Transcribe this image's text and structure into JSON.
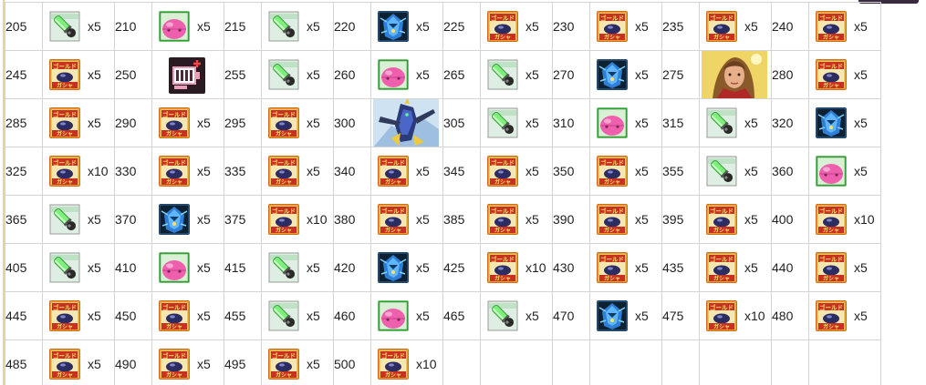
{
  "rows": [
    [
      {
        "n": "205",
        "icon": "tube-item-icon",
        "qty": "x5"
      },
      {
        "n": "210",
        "icon": "pink-haro-icon",
        "qty": "x5"
      },
      {
        "n": "215",
        "icon": "tube-item-icon",
        "qty": "x5"
      },
      {
        "n": "220",
        "icon": "blue-mech-icon",
        "qty": "x5"
      },
      {
        "n": "225",
        "icon": "gold-gacha-ticket-icon",
        "qty": "x5"
      },
      {
        "n": "230",
        "icon": "gold-gacha-ticket-icon",
        "qty": "x5"
      },
      {
        "n": "235",
        "icon": "gold-gacha-ticket-icon",
        "qty": "x5"
      },
      {
        "n": "240",
        "icon": "gold-gacha-ticket-icon",
        "qty": "x5"
      }
    ],
    [
      {
        "n": "245",
        "icon": "gold-gacha-ticket-icon",
        "qty": "x5"
      },
      {
        "n": "250",
        "icon": "slot-expansion-icon",
        "qty": ""
      },
      {
        "n": "255",
        "icon": "tube-item-icon",
        "qty": "x5"
      },
      {
        "n": "260",
        "icon": "pink-haro-icon",
        "qty": "x5"
      },
      {
        "n": "265",
        "icon": "tube-item-icon",
        "qty": "x5"
      },
      {
        "n": "270",
        "icon": "blue-mech-icon",
        "qty": "x5"
      },
      {
        "n": "275",
        "icon": "pilot-portrait-icon",
        "qty": ""
      },
      {
        "n": "280",
        "icon": "gold-gacha-ticket-icon",
        "qty": "x5"
      }
    ],
    [
      {
        "n": "285",
        "icon": "gold-gacha-ticket-icon",
        "qty": "x5"
      },
      {
        "n": "290",
        "icon": "gold-gacha-ticket-icon",
        "qty": "x5"
      },
      {
        "n": "295",
        "icon": "gold-gacha-ticket-icon",
        "qty": "x5"
      },
      {
        "n": "300",
        "icon": "mobile-suit-art-icon",
        "qty": ""
      },
      {
        "n": "305",
        "icon": "tube-item-icon",
        "qty": "x5"
      },
      {
        "n": "310",
        "icon": "pink-haro-icon",
        "qty": "x5"
      },
      {
        "n": "315",
        "icon": "tube-item-icon",
        "qty": "x5"
      },
      {
        "n": "320",
        "icon": "blue-mech-icon",
        "qty": "x5"
      }
    ],
    [
      {
        "n": "325",
        "icon": "gold-gacha-ticket-icon",
        "qty": "x10"
      },
      {
        "n": "330",
        "icon": "gold-gacha-ticket-icon",
        "qty": "x5"
      },
      {
        "n": "335",
        "icon": "gold-gacha-ticket-icon",
        "qty": "x5"
      },
      {
        "n": "340",
        "icon": "gold-gacha-ticket-icon",
        "qty": "x5"
      },
      {
        "n": "345",
        "icon": "gold-gacha-ticket-icon",
        "qty": "x5"
      },
      {
        "n": "350",
        "icon": "gold-gacha-ticket-icon",
        "qty": "x5"
      },
      {
        "n": "355",
        "icon": "tube-item-icon",
        "qty": "x5"
      },
      {
        "n": "360",
        "icon": "pink-haro-icon",
        "qty": "x5"
      }
    ],
    [
      {
        "n": "365",
        "icon": "tube-item-icon",
        "qty": "x5"
      },
      {
        "n": "370",
        "icon": "blue-mech-icon",
        "qty": "x5"
      },
      {
        "n": "375",
        "icon": "gold-gacha-ticket-icon",
        "qty": "x10"
      },
      {
        "n": "380",
        "icon": "gold-gacha-ticket-icon",
        "qty": "x5"
      },
      {
        "n": "385",
        "icon": "gold-gacha-ticket-icon",
        "qty": "x5"
      },
      {
        "n": "390",
        "icon": "gold-gacha-ticket-icon",
        "qty": "x5"
      },
      {
        "n": "395",
        "icon": "gold-gacha-ticket-icon",
        "qty": "x5"
      },
      {
        "n": "400",
        "icon": "gold-gacha-ticket-icon",
        "qty": "x10"
      }
    ],
    [
      {
        "n": "405",
        "icon": "tube-item-icon",
        "qty": "x5"
      },
      {
        "n": "410",
        "icon": "pink-haro-icon",
        "qty": "x5"
      },
      {
        "n": "415",
        "icon": "tube-item-icon",
        "qty": "x5"
      },
      {
        "n": "420",
        "icon": "blue-mech-icon",
        "qty": "x5"
      },
      {
        "n": "425",
        "icon": "gold-gacha-ticket-icon",
        "qty": "x10"
      },
      {
        "n": "430",
        "icon": "gold-gacha-ticket-icon",
        "qty": "x5"
      },
      {
        "n": "435",
        "icon": "gold-gacha-ticket-icon",
        "qty": "x5"
      },
      {
        "n": "440",
        "icon": "gold-gacha-ticket-icon",
        "qty": "x5"
      }
    ],
    [
      {
        "n": "445",
        "icon": "gold-gacha-ticket-icon",
        "qty": "x5"
      },
      {
        "n": "450",
        "icon": "gold-gacha-ticket-icon",
        "qty": "x5"
      },
      {
        "n": "455",
        "icon": "tube-item-icon",
        "qty": "x5"
      },
      {
        "n": "460",
        "icon": "pink-haro-icon",
        "qty": "x5"
      },
      {
        "n": "465",
        "icon": "tube-item-icon",
        "qty": "x5"
      },
      {
        "n": "470",
        "icon": "blue-mech-icon",
        "qty": "x5"
      },
      {
        "n": "475",
        "icon": "gold-gacha-ticket-icon",
        "qty": "x10"
      },
      {
        "n": "480",
        "icon": "gold-gacha-ticket-icon",
        "qty": "x5"
      }
    ],
    [
      {
        "n": "485",
        "icon": "gold-gacha-ticket-icon",
        "qty": "x5"
      },
      {
        "n": "490",
        "icon": "gold-gacha-ticket-icon",
        "qty": "x5"
      },
      {
        "n": "495",
        "icon": "gold-gacha-ticket-icon",
        "qty": "x5"
      },
      {
        "n": "500",
        "icon": "gold-gacha-ticket-icon",
        "qty": "x10"
      },
      null,
      null,
      null,
      null
    ]
  ],
  "colors": {
    "grid_line": "#d4d4d4",
    "tube_green": "#7cf07a",
    "ticket_gold": "#e0a526",
    "ticket_red": "#c83020",
    "haro_pink": "#ee5fae",
    "mech_blue": "#2f7fd6"
  }
}
